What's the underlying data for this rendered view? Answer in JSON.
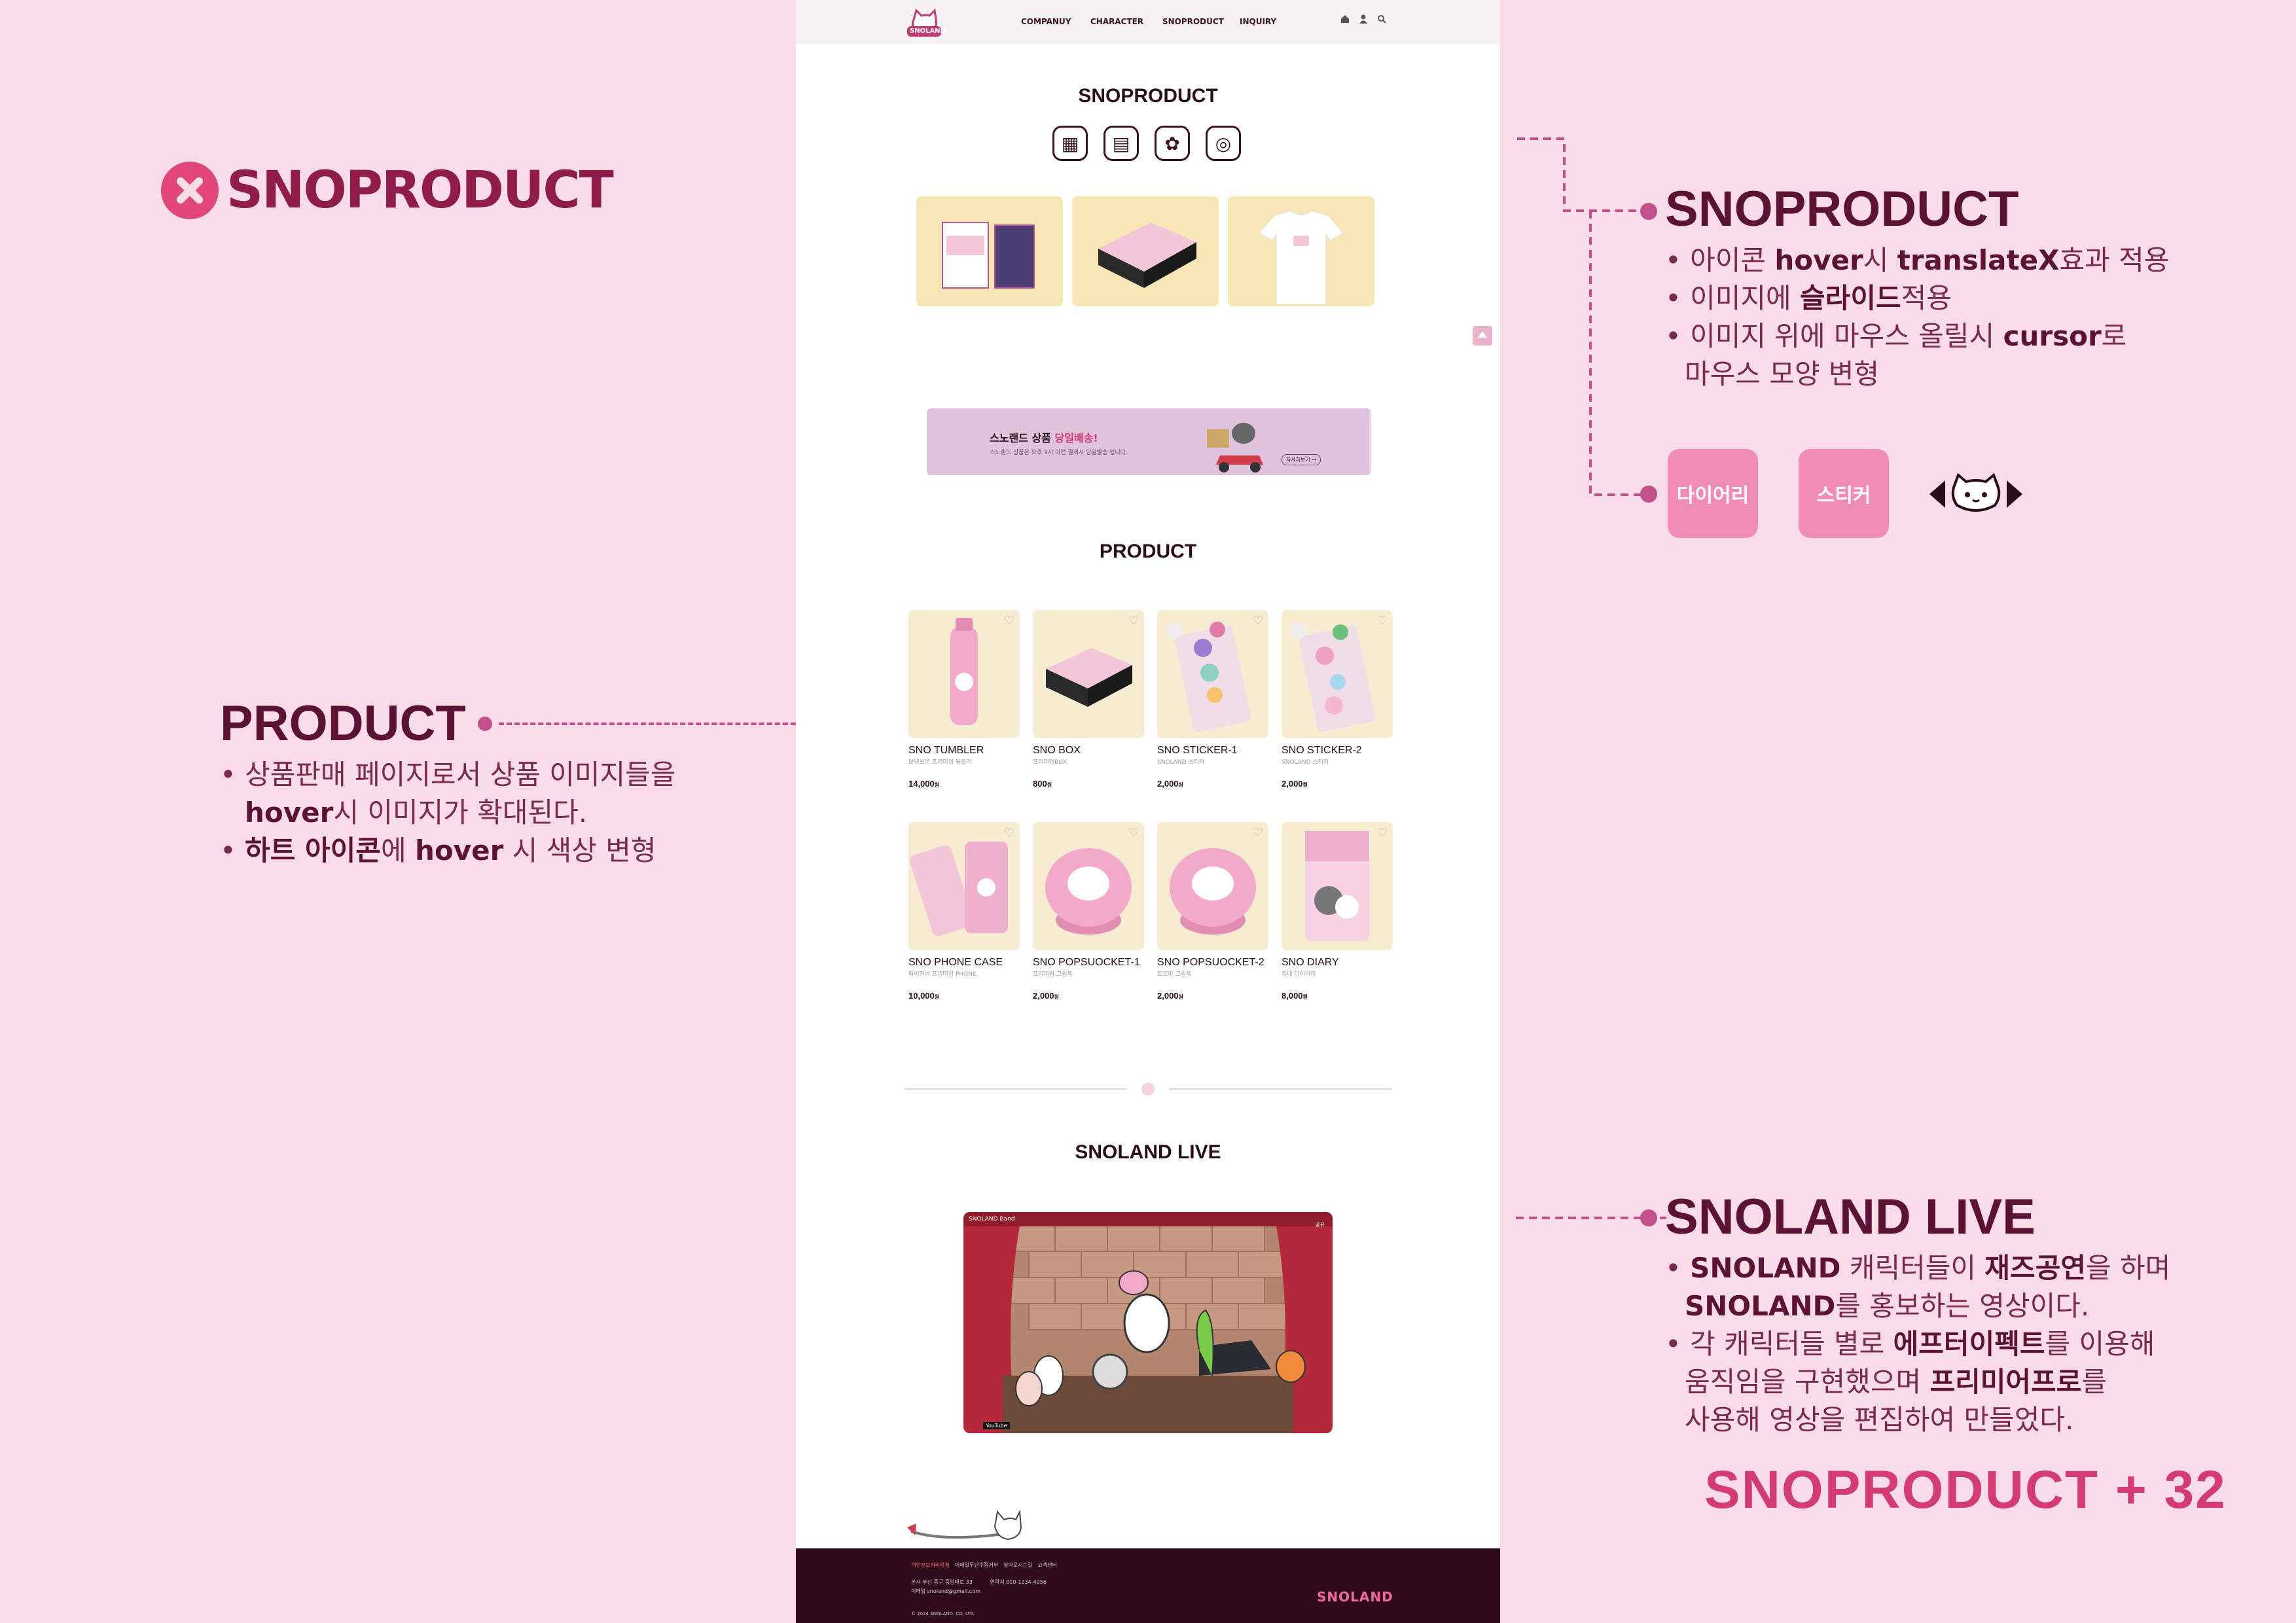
{
  "left": {
    "logo_text": "SNOPRODUCT",
    "product_title": "PRODUCT",
    "product_line1": "• 상품판매 페이지로서 상품 이미지들을",
    "product_line2_bold": "hover",
    "product_line2_rest": "시 이미지가 확대된다.",
    "product_line3_bold": "하트 아이콘",
    "product_line3_mid": "에 ",
    "product_line3_bold2": "hover",
    "product_line3_rest": " 시 색상 변형"
  },
  "right": {
    "snoproduct_title": "SNOPRODUCT",
    "sp_l1_a": "• 아이콘 ",
    "sp_l1_b": "hover",
    "sp_l1_c": "시 ",
    "sp_l1_d": "translateX",
    "sp_l1_e": "효과 적용",
    "sp_l2_a": "• 이미지에 ",
    "sp_l2_b": "슬라이드",
    "sp_l2_c": "적용",
    "sp_l3_a": "• 이미지 위에 마우스 올릴시 ",
    "sp_l3_b": "cursor",
    "sp_l3_c": "로",
    "sp_l4": "마우스 모양 변형",
    "btn_diary": "다이어리",
    "btn_sticker": "스티커",
    "live_title": "SNOLAND LIVE",
    "lv_l1_a": "• ",
    "lv_l1_b": "SNOLAND",
    "lv_l1_c": " 캐릭터들이 ",
    "lv_l1_d": "재즈공연",
    "lv_l1_e": "을 하며",
    "lv_l2_a": "SNOLAND",
    "lv_l2_b": "를 홍보하는 영상이다.",
    "lv_l3_a": "• 각 캐릭터들 별로 ",
    "lv_l3_b": "에프터이펙트",
    "lv_l3_c": "를 이용해",
    "lv_l4_a": "움직임을 구현했으며 ",
    "lv_l4_b": "프리미어프로",
    "lv_l4_c": "를",
    "lv_l5": "사용해 영상을 편집하여 만들었다.",
    "counter": "SNOPRODUCT + 32"
  },
  "site": {
    "logo": "SNOLAND",
    "nav": [
      "COMPANUY",
      "CHARACTER",
      "SNOPRODUCT",
      "INQUIRY"
    ],
    "snoproduct_title": "SNOPRODUCT",
    "banner_title_a": "스노랜드 상품 ",
    "banner_title_b": "당일배송!",
    "banner_sub": "스노랜드 상품은 오후 1시 이전 결제시 당일발송 됩니다.",
    "banner_btn": "자세히보기 →",
    "product_title": "PRODUCT",
    "products": [
      {
        "name": "SNO TUMBLER",
        "sub": "보냉보온 프리미엄 텀블러",
        "price": "14,000",
        "unit": "원"
      },
      {
        "name": "SNO BOX",
        "sub": "프리미엄BOX",
        "price": "800",
        "unit": "원"
      },
      {
        "name": "SNO STICKER-1",
        "sub": "SNOLAND 스티커",
        "price": "2,000",
        "unit": "원"
      },
      {
        "name": "SNO STICKER-2",
        "sub": "SNOLAND 스티커",
        "price": "2,000",
        "unit": "원"
      },
      {
        "name": "SNO PHONE CASE",
        "sub": "파이커버 프리미엄 PHONE",
        "price": "10,000",
        "unit": "원"
      },
      {
        "name": "SNO POPSUOCKET-1",
        "sub": "프리미엄 그립톡",
        "price": "2,000",
        "unit": "원"
      },
      {
        "name": "SNO POPSUOCKET-2",
        "sub": "토르마 그립톡",
        "price": "2,000",
        "unit": "원"
      },
      {
        "name": "SNO DIARY",
        "sub": "특대 다이어리",
        "price": "8,000",
        "unit": "원"
      }
    ],
    "live_title": "SNOLAND LIVE",
    "video_label": "SNOLAND Band",
    "video_share": "공유",
    "video_source": "YouTube",
    "footer_links": [
      "개인정보처리방침",
      "이메일무단수집거부",
      "찾아오시는길",
      "고객센터"
    ],
    "footer_addr_label": "본사",
    "footer_addr": "부산 중구 중앙대로 33",
    "footer_tel_label": "연락처",
    "footer_tel": "010-1234-4056",
    "footer_mail_label": "이메일",
    "footer_mail": "snoland@gmail.com",
    "footer_copy": "© 2024 SNOLAND. CO. LTD.",
    "footer_logo": "SNOLAND"
  },
  "colors": {
    "background": "#f9dce7",
    "accent_pink": "#e0467a",
    "dark_plum": "#5b1236",
    "button_pink": "#f08cb7",
    "footer": "#2e0a1a"
  }
}
